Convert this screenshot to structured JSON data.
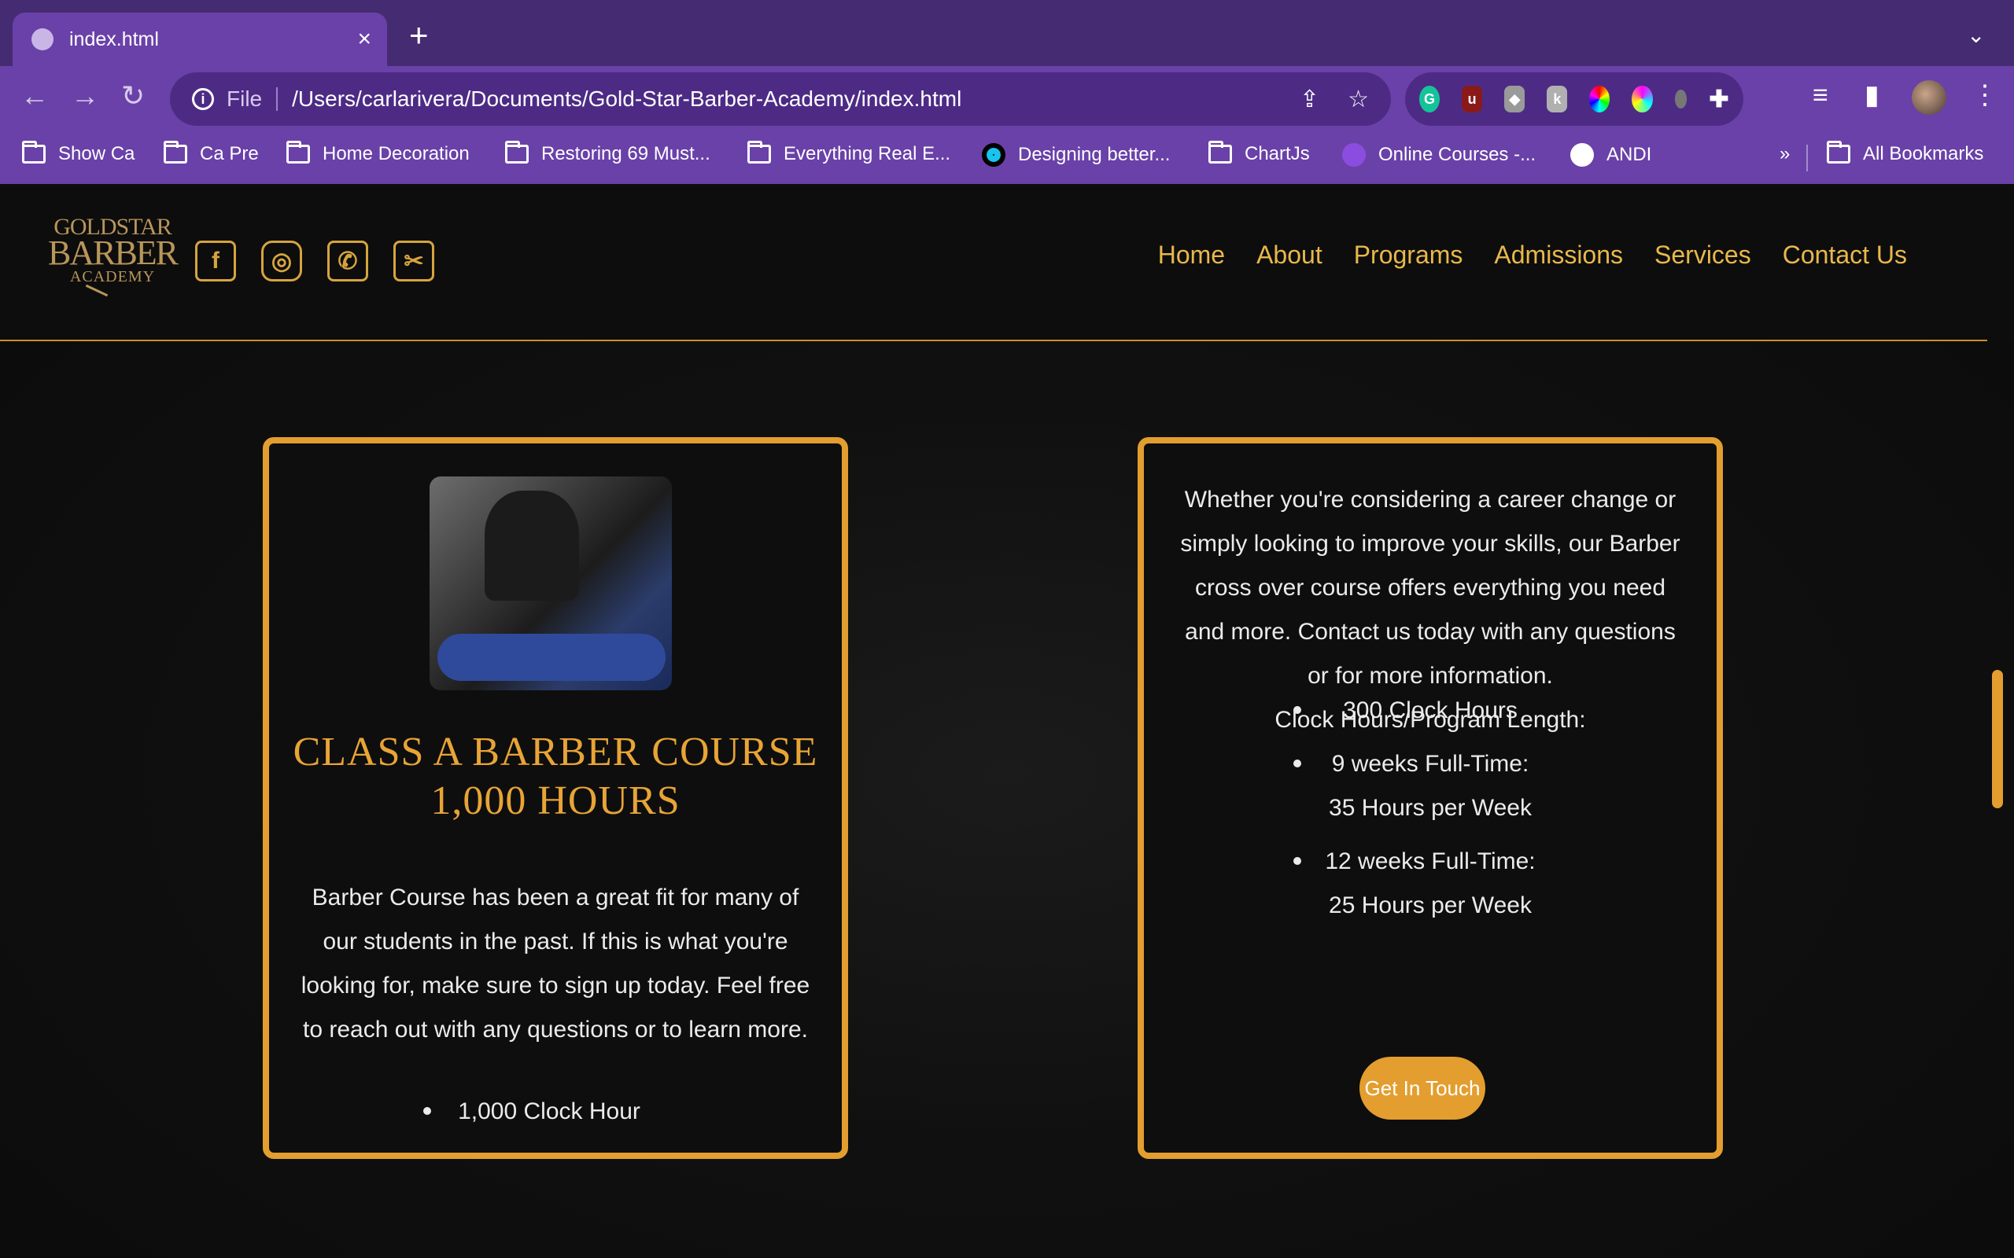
{
  "browser": {
    "tab_title": "index.html",
    "tab_close": "×",
    "new_tab": "+",
    "tab_menu": "⌄",
    "scheme": "File",
    "url": "/Users/carlarivera/Documents/Gold-Star-Barber-Academy/index.html",
    "bookmarks": [
      {
        "label": "Show Ca",
        "icon": "folder-icon"
      },
      {
        "label": "Ca Pre",
        "icon": "folder-icon"
      },
      {
        "label": "Home Decoration",
        "icon": "folder-icon"
      },
      {
        "label": "Restoring 69 Must...",
        "icon": "folder-icon"
      },
      {
        "label": "Everything Real E...",
        "icon": "folder-icon"
      },
      {
        "label": "Designing better...",
        "icon": "site-icon"
      },
      {
        "label": "ChartJs",
        "icon": "folder-icon"
      },
      {
        "label": "Online Courses -...",
        "icon": "site-icon"
      },
      {
        "label": "ANDI",
        "icon": "globe-icon"
      }
    ],
    "more_bookmarks": "»",
    "all_bookmarks": "All Bookmarks"
  },
  "site": {
    "logo": {
      "line1": "GOLDSTAR",
      "line2": "BARBER",
      "line3": "ACADEMY"
    },
    "nav": [
      "Home",
      "About",
      "Programs",
      "Admissions",
      "Services",
      "Contact Us"
    ]
  },
  "card_left": {
    "title": "CLASS A BARBER COURSE 1,000 HOURS",
    "body": "Barber Course has been a great fit for many of our students in the past. If this is what you're looking for, make sure to sign up today. Feel free to reach out with any questions or to learn more.",
    "bullets": [
      "1,000 Clock Hour"
    ]
  },
  "card_right": {
    "body": "Whether you're considering a career change or simply looking to improve your skills, our Barber cross over course offers everything you need and more. Contact us today with any questions or for more information.",
    "hours_label": "Clock Hours/Program Length:",
    "bullets": [
      {
        "line1": "300 Clock Hours",
        "line2": ""
      },
      {
        "line1": "9 weeks Full-Time:",
        "line2": "35 Hours per Week"
      },
      {
        "line1": "12 weeks Full-Time:",
        "line2": "25 Hours per Week"
      }
    ],
    "cta": "Get In Touch"
  },
  "colors": {
    "accent": "#e39e2f",
    "nav_text": "#e8b84b",
    "chrome": "#6a41a8"
  }
}
